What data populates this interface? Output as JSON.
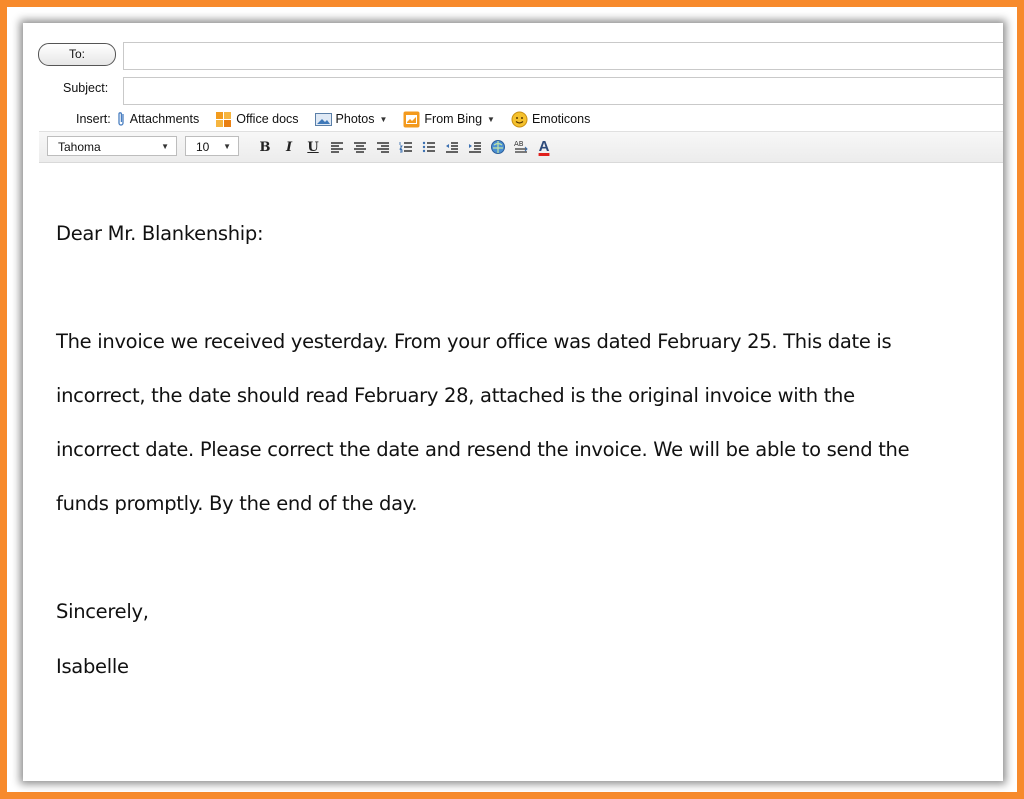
{
  "compose": {
    "to_label": "To:",
    "to_value": "",
    "subject_label": "Subject:",
    "subject_value": "",
    "insert": {
      "label": "Insert:",
      "items": [
        {
          "label": "Attachments",
          "icon": "paperclip-icon"
        },
        {
          "label": "Office docs",
          "icon": "office-docs-icon"
        },
        {
          "label": "Photos",
          "icon": "photos-icon",
          "dropdown": true
        },
        {
          "label": "From Bing",
          "icon": "bing-icon",
          "dropdown": true
        },
        {
          "label": "Emoticons",
          "icon": "emoticon-icon"
        }
      ]
    },
    "format": {
      "font": "Tahoma",
      "size": "10",
      "bold": "B",
      "italic": "I",
      "underline": "U",
      "font_color_glyph": "A"
    }
  },
  "message": {
    "greeting": "Dear Mr. Blankenship:",
    "lines": [
      "The invoice we received yesterday. From your office was dated February 25.  This date is",
      "incorrect, the date should read February 28, attached is the original invoice with the",
      "incorrect date. Please correct the date and resend the invoice. We will be able to send the",
      "funds promptly. By the end of the day."
    ],
    "closing": "Sincerely,",
    "signature": "Isabelle"
  },
  "colors": {
    "border": "#f78a2c",
    "font_color_underline": "#e0201c"
  }
}
